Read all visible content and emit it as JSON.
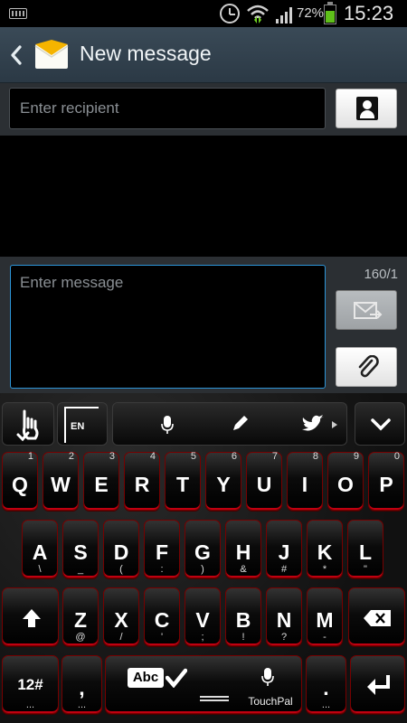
{
  "status_bar": {
    "battery_percent": "72%",
    "battery_level": 0.72,
    "time": "15:23"
  },
  "action_bar": {
    "title": "New message"
  },
  "recipient": {
    "placeholder": "Enter recipient"
  },
  "composer": {
    "placeholder": "Enter message",
    "counter": "160/1"
  },
  "keyboard": {
    "toolbar": {
      "lang_label": "EN"
    },
    "rows": [
      [
        {
          "key": "Q",
          "hint": "1"
        },
        {
          "key": "W",
          "hint": "2"
        },
        {
          "key": "E",
          "hint": "3"
        },
        {
          "key": "R",
          "hint": "4"
        },
        {
          "key": "T",
          "hint": "5"
        },
        {
          "key": "Y",
          "hint": "6"
        },
        {
          "key": "U",
          "hint": "7"
        },
        {
          "key": "I",
          "hint": "8"
        },
        {
          "key": "O",
          "hint": "9"
        },
        {
          "key": "P",
          "hint": "0"
        }
      ],
      [
        {
          "key": "A",
          "hint": "\\"
        },
        {
          "key": "S",
          "hint": "_"
        },
        {
          "key": "D",
          "hint": "("
        },
        {
          "key": "F",
          "hint": ":"
        },
        {
          "key": "G",
          "hint": ")"
        },
        {
          "key": "H",
          "hint": "&"
        },
        {
          "key": "J",
          "hint": "#"
        },
        {
          "key": "K",
          "hint": "*"
        },
        {
          "key": "L",
          "hint": "\""
        }
      ],
      [
        {
          "key": "Z",
          "hint": "@"
        },
        {
          "key": "X",
          "hint": "/"
        },
        {
          "key": "C",
          "hint": "'"
        },
        {
          "key": "V",
          "hint": ";"
        },
        {
          "key": "B",
          "hint": "!"
        },
        {
          "key": "N",
          "hint": "?"
        },
        {
          "key": "M",
          "hint": "-"
        }
      ]
    ],
    "bottom": {
      "numbers_label": "12#",
      "numbers_hint": "...",
      "comma_label": ",",
      "comma_hint": "...",
      "abc_label": "Abc",
      "space_brand": "TouchPal",
      "period_label": ".",
      "period_hint": "..."
    }
  },
  "colors": {
    "accent_blue": "#2d95d8",
    "key_border_red": "#c00010",
    "action_bar": "#2b3945"
  }
}
